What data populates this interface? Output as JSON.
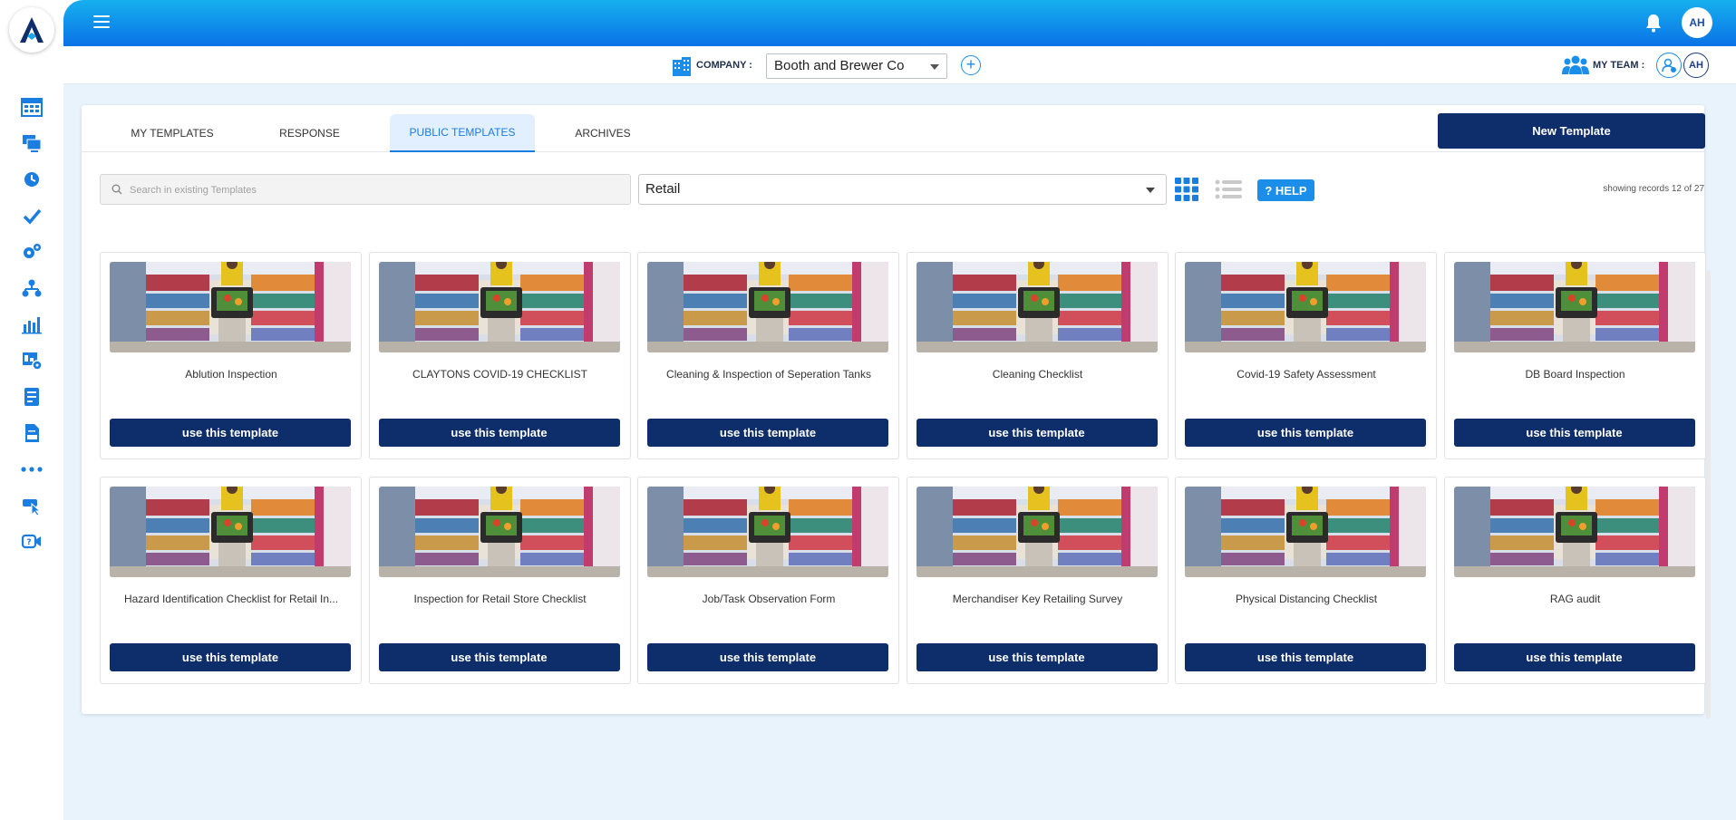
{
  "app": {
    "logo_alt": "app-logo"
  },
  "topbar": {
    "avatar_initials": "AH"
  },
  "company": {
    "label": "COMPANY :",
    "selected": "Booth and Brewer Co"
  },
  "team": {
    "label": "MY TEAM :",
    "member_initials": "AH"
  },
  "tabs": [
    {
      "label": "MY TEMPLATES",
      "active": false
    },
    {
      "label": "RESPONSE",
      "active": false
    },
    {
      "label": "PUBLIC TEMPLATES",
      "active": true
    },
    {
      "label": "ARCHIVES",
      "active": false
    }
  ],
  "new_template_label": "New Template",
  "search": {
    "placeholder": "Search in existing Templates",
    "value": ""
  },
  "category": {
    "selected": "Retail"
  },
  "help_label": "? HELP",
  "records_text": "showing records 12 of 27",
  "button_label": "use this template",
  "templates": [
    {
      "title": "Ablution Inspection"
    },
    {
      "title": "CLAYTONS COVID-19 CHECKLIST"
    },
    {
      "title": "Cleaning & Inspection of Seperation Tanks"
    },
    {
      "title": "Cleaning Checklist"
    },
    {
      "title": "Covid-19 Safety Assessment"
    },
    {
      "title": "DB Board Inspection"
    },
    {
      "title": "Hazard Identification Checklist for Retail In..."
    },
    {
      "title": "Inspection for Retail Store Checklist"
    },
    {
      "title": "Job/Task Observation Form"
    },
    {
      "title": "Merchandiser Key Retailing Survey"
    },
    {
      "title": "Physical Distancing Checklist"
    },
    {
      "title": "RAG audit"
    }
  ],
  "colors": {
    "primary_dark": "#0d2d6b",
    "accent_blue": "#1a8ee8",
    "topbar_gradient_start": "#16b0ef",
    "topbar_gradient_end": "#0a72e6"
  },
  "sidebar_icons": [
    "calendar-grid-icon",
    "monitor-stack-icon",
    "clock-icon",
    "checkmark-icon",
    "gears-icon",
    "org-chart-icon",
    "bar-chart-icon",
    "report-settings-icon",
    "form-doc-icon",
    "document-icon",
    "more-dots-icon",
    "click-pointer-icon",
    "video-help-icon"
  ]
}
